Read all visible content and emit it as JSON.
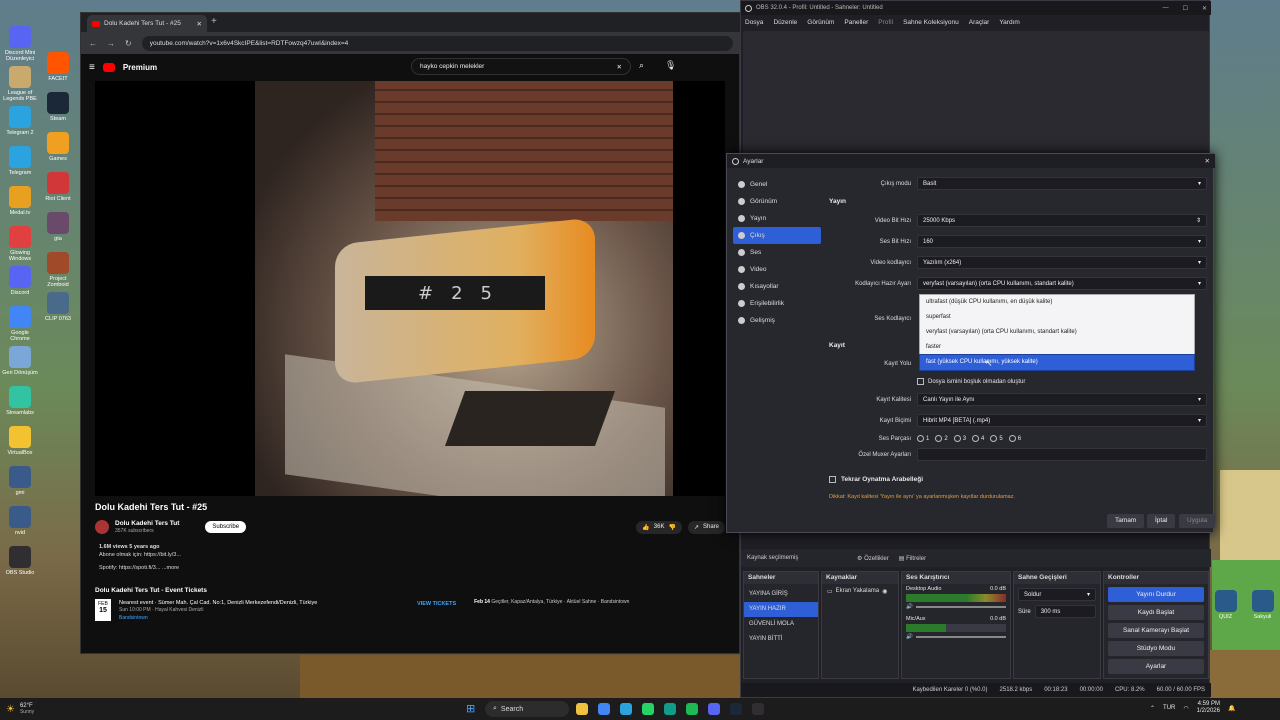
{
  "desktop": {
    "icons_left": [
      {
        "label": "Discord Mini\nDüzenleyici",
        "color": "#5865f2"
      },
      {
        "label": "League of\nLegends PBE",
        "color": "#c8aa6e"
      },
      {
        "label": "Telegram 2",
        "color": "#2aa3df"
      },
      {
        "label": "Telegram",
        "color": "#2aa3df"
      },
      {
        "label": "Medal.tv",
        "color": "#e8a020"
      },
      {
        "label": "Glowing\nWindows",
        "color": "#e04040"
      },
      {
        "label": "Discord",
        "color": "#5865f2"
      },
      {
        "label": "Google\nChrome",
        "color": "#4285f4"
      },
      {
        "label": "Geri Dönüşüm",
        "color": "#7aa7d8"
      },
      {
        "label": "Streamlabs",
        "color": "#31c3a2"
      },
      {
        "label": "VirtualBox",
        "color": "#f2c230"
      },
      {
        "label": "gmi",
        "color": "#3a5a8a"
      },
      {
        "label": "nvid",
        "color": "#3a5a8a"
      },
      {
        "label": "OBS Studio",
        "color": "#302e31"
      }
    ],
    "icons_left2": [
      {
        "label": "FACEIT",
        "color": "#ff5500"
      },
      {
        "label": "Steam",
        "color": "#1b2838"
      },
      {
        "label": "Games",
        "color": "#f0a020"
      },
      {
        "label": "Riot Client",
        "color": "#d13639"
      },
      {
        "label": "gta",
        "color": "#6a4a6a"
      },
      {
        "label": "Project\nZomboid",
        "color": "#a04a2a"
      },
      {
        "label": "CLIP 0763",
        "color": "#4a6a8a"
      }
    ],
    "icons_right": [
      {
        "label": "QUIZ",
        "color": "#2a5a8a"
      },
      {
        "label": "Sakyuli",
        "color": "#2a5a8a"
      }
    ]
  },
  "browser": {
    "tab_title": "Dolu Kadehi Ters Tut - #25",
    "url": "youtube.com/watch?v=1x6v4SkcIPE&list=RDTFowzq47uwI&index=4",
    "yt_brand": "Premium",
    "search_query": "hayko cepkin melekler",
    "video_digits": [
      "#",
      "2",
      "5"
    ],
    "video_title": "Dolu Kadehi Ters Tut - #25",
    "channel_name": "Dolu Kadehi Ters Tut",
    "channel_subs": "357K subscribers",
    "subscribe_label": "Subscribe",
    "likes": "36K",
    "share_label": "Share",
    "desc_stats": "1.6M views  5 years ago",
    "desc_line1": "Abone olmak için: https://bit.ly/3...",
    "desc_line2": "Spotify: https://spoti.fi/3...  ...more",
    "event_heading": "Dolu Kadehi Ters Tut - Event Tickets",
    "event1_month": "FEB",
    "event1_day": "15",
    "event1_title": "Nearest event · Sümer Mah. Çal Cad. No:1, Denizli Merkezefendi/Denizli, Türkiye",
    "event1_time": "Sun 10:00 PM · Hayal Kahvesi Denizli",
    "event1_vendor": "Bandsintown",
    "view_tickets": "VIEW TICKETS",
    "event2_date": "Feb 14",
    "event2_text": "Geçitler, Kapaz/Antalya, Türkiye · Aktüel Sahne · Bandsintown"
  },
  "obs": {
    "title": "OBS 32.0.4 - Profil: Untitled - Sahneler: Untitled",
    "menu": [
      "Dosya",
      "Düzenle",
      "Görünüm",
      "Paneller",
      "Profil",
      "Sahne Koleksiyonu",
      "Araçlar",
      "Yardım"
    ],
    "source_bar": [
      "Kaynak seçilmemiş",
      "Özellikler",
      "Filtreler"
    ],
    "docks": {
      "scenes_title": "Sahneler",
      "scenes": [
        "YAYINA GİRİŞ",
        "YAYIN HAZIR",
        "GÜVENLİ MOLA",
        "YAYIN BİTTİ"
      ],
      "selected_scene": 1,
      "sources_title": "Kaynaklar",
      "source_item": "Ekran Yakalama",
      "mixer_title": "Ses Karıştırıcı",
      "mixer_ch1": "Desktop Audio",
      "mixer_ch1_db": "0.0 dB",
      "mixer_ch2": "Mic/Aux",
      "mixer_ch2_db": "0.0 dB",
      "transitions_title": "Sahne Geçişleri",
      "transition_value": "Soldur",
      "duration_label": "Süre",
      "duration_value": "300 ms",
      "controls_title": "Kontroller",
      "controls": [
        "Yayını Durdur",
        "Kaydı Başlat",
        "Sanal Kamerayı Başlat",
        "Stüdyo Modu",
        "Ayarlar"
      ]
    },
    "status": [
      "Kaybedilen Kareler 0 (%0.0)",
      "2518.2 kbps",
      "00:18:23",
      "00:00:00",
      "CPU: 8.2%",
      "60.00 / 60.00 FPS"
    ]
  },
  "settings": {
    "title": "Ayarlar",
    "nav": [
      {
        "label": "Genel",
        "icon": "gear-icon"
      },
      {
        "label": "Görünüm",
        "icon": "palette-icon"
      },
      {
        "label": "Yayın",
        "icon": "antenna-icon"
      },
      {
        "label": "Çıkış",
        "icon": "output-icon"
      },
      {
        "label": "Ses",
        "icon": "speaker-icon"
      },
      {
        "label": "Video",
        "icon": "monitor-icon"
      },
      {
        "label": "Kısayollar",
        "icon": "keyboard-icon"
      },
      {
        "label": "Erişilebilirlik",
        "icon": "accessibility-icon"
      },
      {
        "label": "Gelişmiş",
        "icon": "wrench-icon"
      }
    ],
    "selected_nav": 3,
    "output_mode_label": "Çıkış modu",
    "output_mode_value": "Basit",
    "stream_section": "Yayın",
    "video_bitrate_label": "Video Bit Hızı",
    "video_bitrate_value": "25000 Kbps",
    "audio_bitrate_label": "Ses Bit Hızı",
    "audio_bitrate_value": "160",
    "video_encoder_label": "Video kodlayıcı",
    "video_encoder_value": "Yazılım (x264)",
    "preset_label": "Kodlayıcı Hazır Ayarı",
    "preset_value": "veryfast (varsayılan) (orta CPU kullanımı, standart kalite)",
    "audio_encoder_label": "Ses Kodlayıcı",
    "preset_options": [
      "ultrafast (düşük CPU kullanımı, en düşük kalite)",
      "superfast",
      "veryfast (varsayılan) (orta CPU kullanımı, standart kalite)",
      "faster",
      "fast (yüksek CPU kullanımı, yüksek kalite)"
    ],
    "preset_highlight": 4,
    "record_section": "Kayıt",
    "record_path_label": "Kayıt Yolu",
    "no_space_label": "Dosya ismini boşluk olmadan oluştur",
    "record_quality_label": "Kayıt Kalitesi",
    "record_quality_value": "Canlı Yayın ile Aynı",
    "record_format_label": "Kayıt Biçimi",
    "record_format_value": "Hibrit MP4 [BETA] (.mp4)",
    "audio_tracks_label": "Ses Parçası",
    "audio_tracks": [
      "1",
      "2",
      "3",
      "4",
      "5",
      "6"
    ],
    "muxer_label": "Özel Muxer Ayarları",
    "replay_label": "Tekrar Oynatma Arabelleği",
    "warning": "Dikkat: Kayıt kalitesi 'Yayın ile aynı' ya ayarlanmışken kayıtlar durdurulamaz.",
    "ok_label": "Tamam",
    "cancel_label": "İptal",
    "apply_label": "Uygula"
  },
  "taskbar": {
    "weather_temp": "62°F",
    "weather_desc": "Sunny",
    "search_label": "Search",
    "lang": "TUR",
    "time": "4:59 PM",
    "date": "1/2/2026"
  },
  "colors": {
    "accent": "#2f5fd6",
    "youtube_red": "#ff0000",
    "warning": "#e0a040"
  }
}
